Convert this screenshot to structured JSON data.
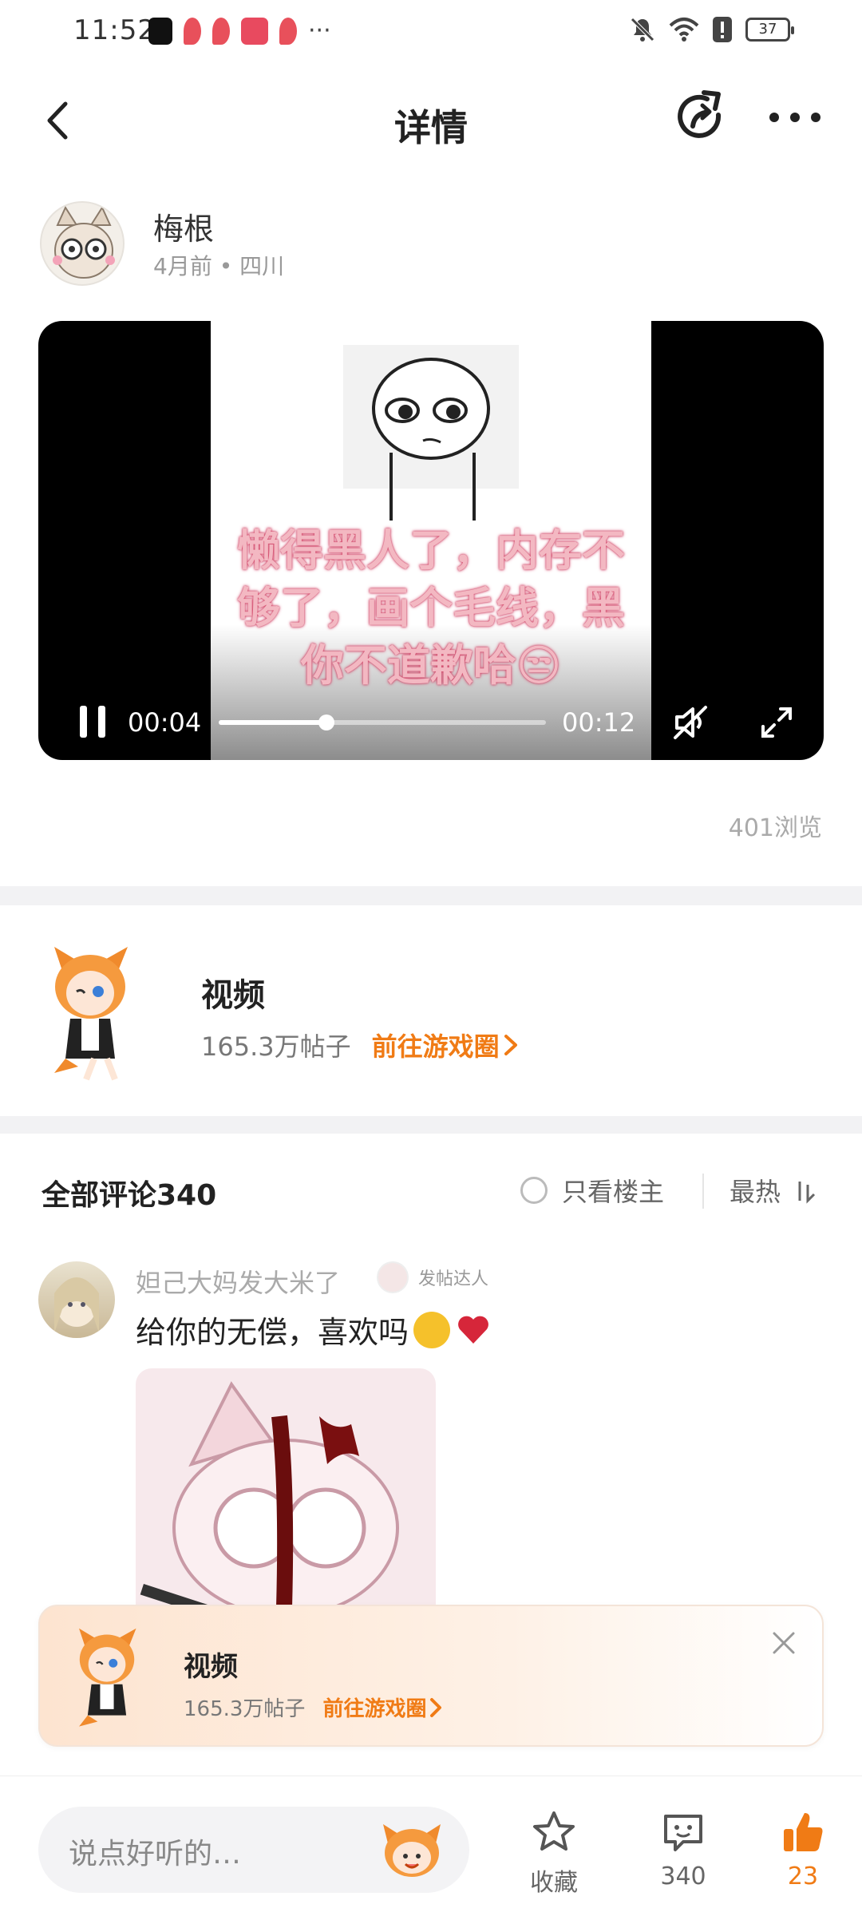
{
  "status_bar": {
    "time": "11:52",
    "battery": "37",
    "more_notifications": "···"
  },
  "nav": {
    "title": "详情"
  },
  "author": {
    "name": "梅根",
    "meta": "4月前 • 四川"
  },
  "video": {
    "caption": "懒得黑人了，内存不够了，画个毛线，黑你不道歉哈😒",
    "current_time": "00:04",
    "total_time": "00:12",
    "progress_fraction": 0.33
  },
  "views": "401浏览",
  "circle": {
    "name": "视频",
    "posts": "165.3万帖子",
    "goto": "前往游戏圈"
  },
  "comments": {
    "title": "全部评论340",
    "only_op": "只看楼主",
    "sort": "最热",
    "items": [
      {
        "name": "妲己大妈发大米了",
        "badge": "发帖达人",
        "text": "给你的无偿，喜欢吗"
      }
    ]
  },
  "banner": {
    "name": "视频",
    "posts": "165.3万帖子",
    "goto": "前往游戏圈"
  },
  "bottom": {
    "input_placeholder": "说点好听的…",
    "favorite_label": "收藏",
    "comment_count": "340",
    "like_count": "23"
  },
  "colors": {
    "accent": "#f07b15",
    "caption_pink": "#f3b8c2"
  }
}
